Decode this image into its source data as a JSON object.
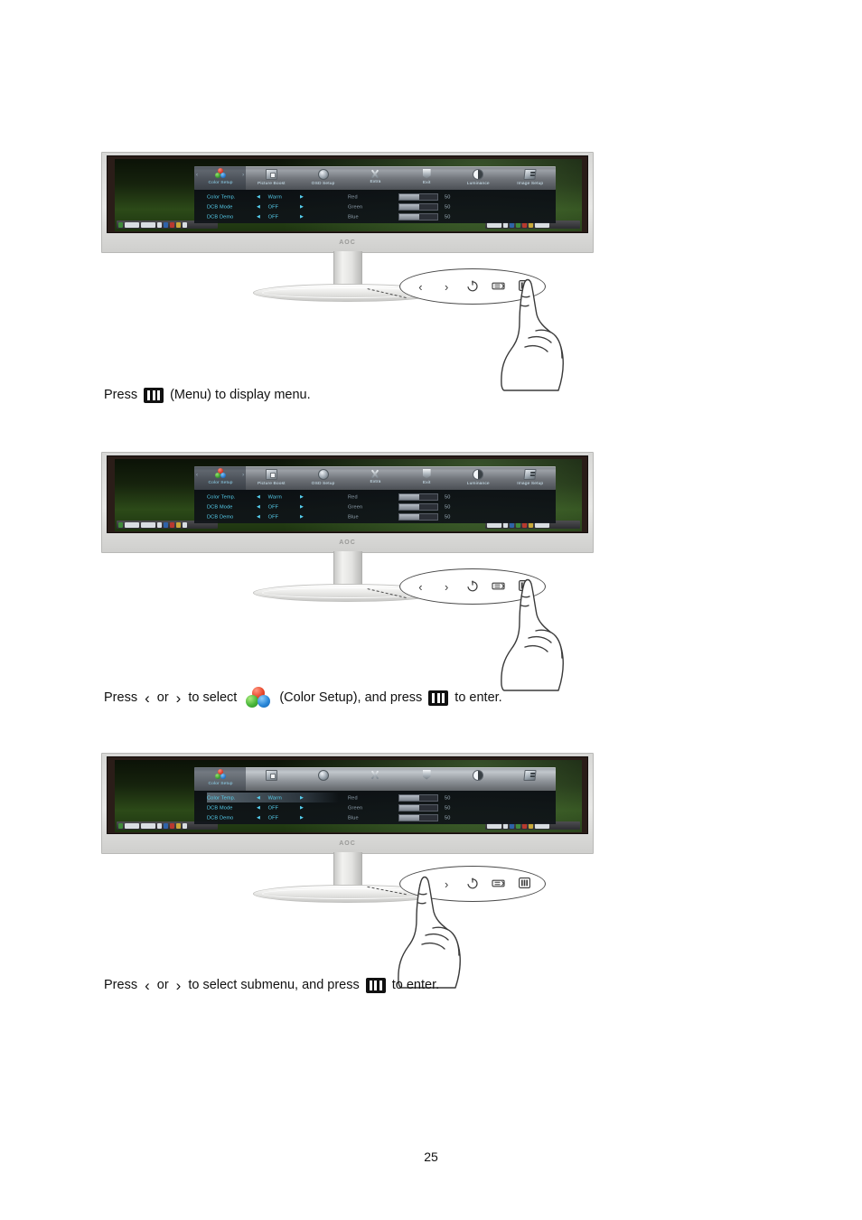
{
  "page": {
    "number": "25"
  },
  "osd": {
    "menu_items": [
      {
        "label": "Color Setup",
        "icon": "color-setup-icon"
      },
      {
        "label": "Picture Boost",
        "icon": "picture-boost-icon"
      },
      {
        "label": "OSD Setup",
        "icon": "osd-setup-icon"
      },
      {
        "label": "Extra",
        "icon": "extra-icon"
      },
      {
        "label": "Exit",
        "icon": "exit-icon"
      },
      {
        "label": "Luminance",
        "icon": "luminance-icon"
      },
      {
        "label": "Image Setup",
        "icon": "image-setup-icon"
      }
    ],
    "nav_left": "‹",
    "nav_right": "›",
    "left_rows": [
      {
        "name": "Color Temp.",
        "left_arrow": "◀",
        "value": "Warm",
        "right_arrow": "▶"
      },
      {
        "name": "DCB Mode",
        "left_arrow": "◀",
        "value": "OFF",
        "right_arrow": "▶"
      },
      {
        "name": "DCB Demo",
        "left_arrow": "◀",
        "value": "OFF",
        "right_arrow": "▶"
      }
    ],
    "right_rows": [
      {
        "name": "Red",
        "value": "50"
      },
      {
        "name": "Green",
        "value": "50"
      },
      {
        "name": "Blue",
        "value": "50"
      }
    ]
  },
  "monitor": {
    "brand_logo": "AOC"
  },
  "controls": {
    "left_label": "‹",
    "right_label": "›",
    "power_name": "power-button",
    "source_name": "source-button",
    "menu_name": "menu-button"
  },
  "figures": [
    {
      "id": "figure-1",
      "pressed_button": "menu-button",
      "osd_state": "main-menu"
    },
    {
      "id": "figure-2",
      "pressed_button": "menu-button",
      "osd_state": "main-menu"
    },
    {
      "id": "figure-3",
      "pressed_button": "right-button",
      "osd_state": "submenu-selected"
    }
  ],
  "captions": {
    "step1": {
      "before": "Press",
      "icon": "menu-key-icon",
      "after": "(Menu) to display menu."
    },
    "step2": {
      "before": "Press",
      "left_arrow": "‹",
      "or": "or",
      "right_arrow": "›",
      "middle": "to select",
      "icon": "color-setup-icon",
      "after_icon": "(Color Setup), and press",
      "menu_icon": "menu-key-icon",
      "end": "to enter."
    },
    "step3": {
      "before": "Press",
      "left_arrow": "‹",
      "or": "or",
      "right_arrow": "›",
      "middle": "to select submenu, and press",
      "menu_icon": "menu-key-icon",
      "end": "to enter."
    }
  }
}
